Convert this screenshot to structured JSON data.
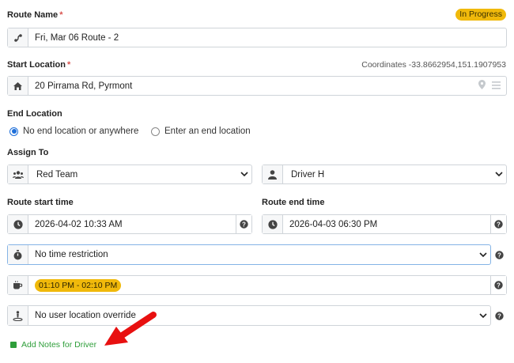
{
  "route_name": {
    "label": "Route Name",
    "required_mark": "*",
    "status_badge": "In Progress",
    "value": "Fri, Mar 06 Route - 2",
    "icon": "route-icon"
  },
  "start_location": {
    "label": "Start Location",
    "required_mark": "*",
    "coordinates_text": "Coordinates -33.8662954,151.1907953",
    "value": "20 Pirrama Rd, Pyrmont",
    "icon": "home-icon"
  },
  "end_location": {
    "label": "End Location",
    "options": [
      {
        "label": "No end location or anywhere",
        "selected": true
      },
      {
        "label": "Enter an end location",
        "selected": false
      }
    ]
  },
  "assign_to": {
    "label": "Assign To",
    "team": "Red Team",
    "driver": "Driver H"
  },
  "times": {
    "start_label": "Route start time",
    "start_value": "2026-04-02 10:33 AM",
    "end_label": "Route end time",
    "end_value": "2026-04-03 06:30 PM"
  },
  "time_restriction": {
    "value": "No time restriction"
  },
  "break": {
    "value": "01:10 PM - 02:10 PM"
  },
  "location_override": {
    "value": "No user location override"
  },
  "notes_link": {
    "label": "Add Notes for Driver"
  },
  "colors": {
    "badge": "#f0b90b",
    "link_green": "#2e9e3a",
    "arrow_red": "#e81010",
    "radio_blue": "#1e6fd9"
  }
}
